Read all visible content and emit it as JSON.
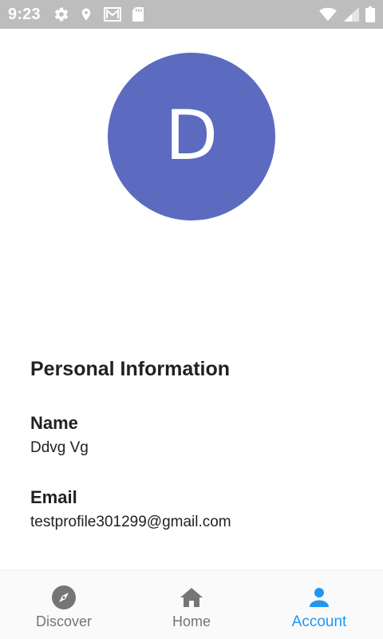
{
  "status_bar": {
    "time": "9:23",
    "background": "#bdbdbd",
    "left_icons": [
      "settings-icon",
      "location-icon",
      "gmail-icon",
      "sd-card-icon"
    ],
    "right_icons": [
      "wifi-icon",
      "cell-signal-icon",
      "battery-icon"
    ]
  },
  "profile": {
    "avatar_initial": "D",
    "avatar_color": "#5c6bc0"
  },
  "personal_info": {
    "title": "Personal Information",
    "name_label": "Name",
    "name_value": "Ddvg Vg",
    "email_label": "Email",
    "email_value": "testprofile301299@gmail.com"
  },
  "bottom_nav": {
    "items": [
      {
        "label": "Discover",
        "icon": "compass-icon",
        "active": false
      },
      {
        "label": "Home",
        "icon": "home-icon",
        "active": false
      },
      {
        "label": "Account",
        "icon": "person-icon",
        "active": true
      }
    ],
    "active_color": "#2196f3",
    "inactive_color": "#757575"
  }
}
